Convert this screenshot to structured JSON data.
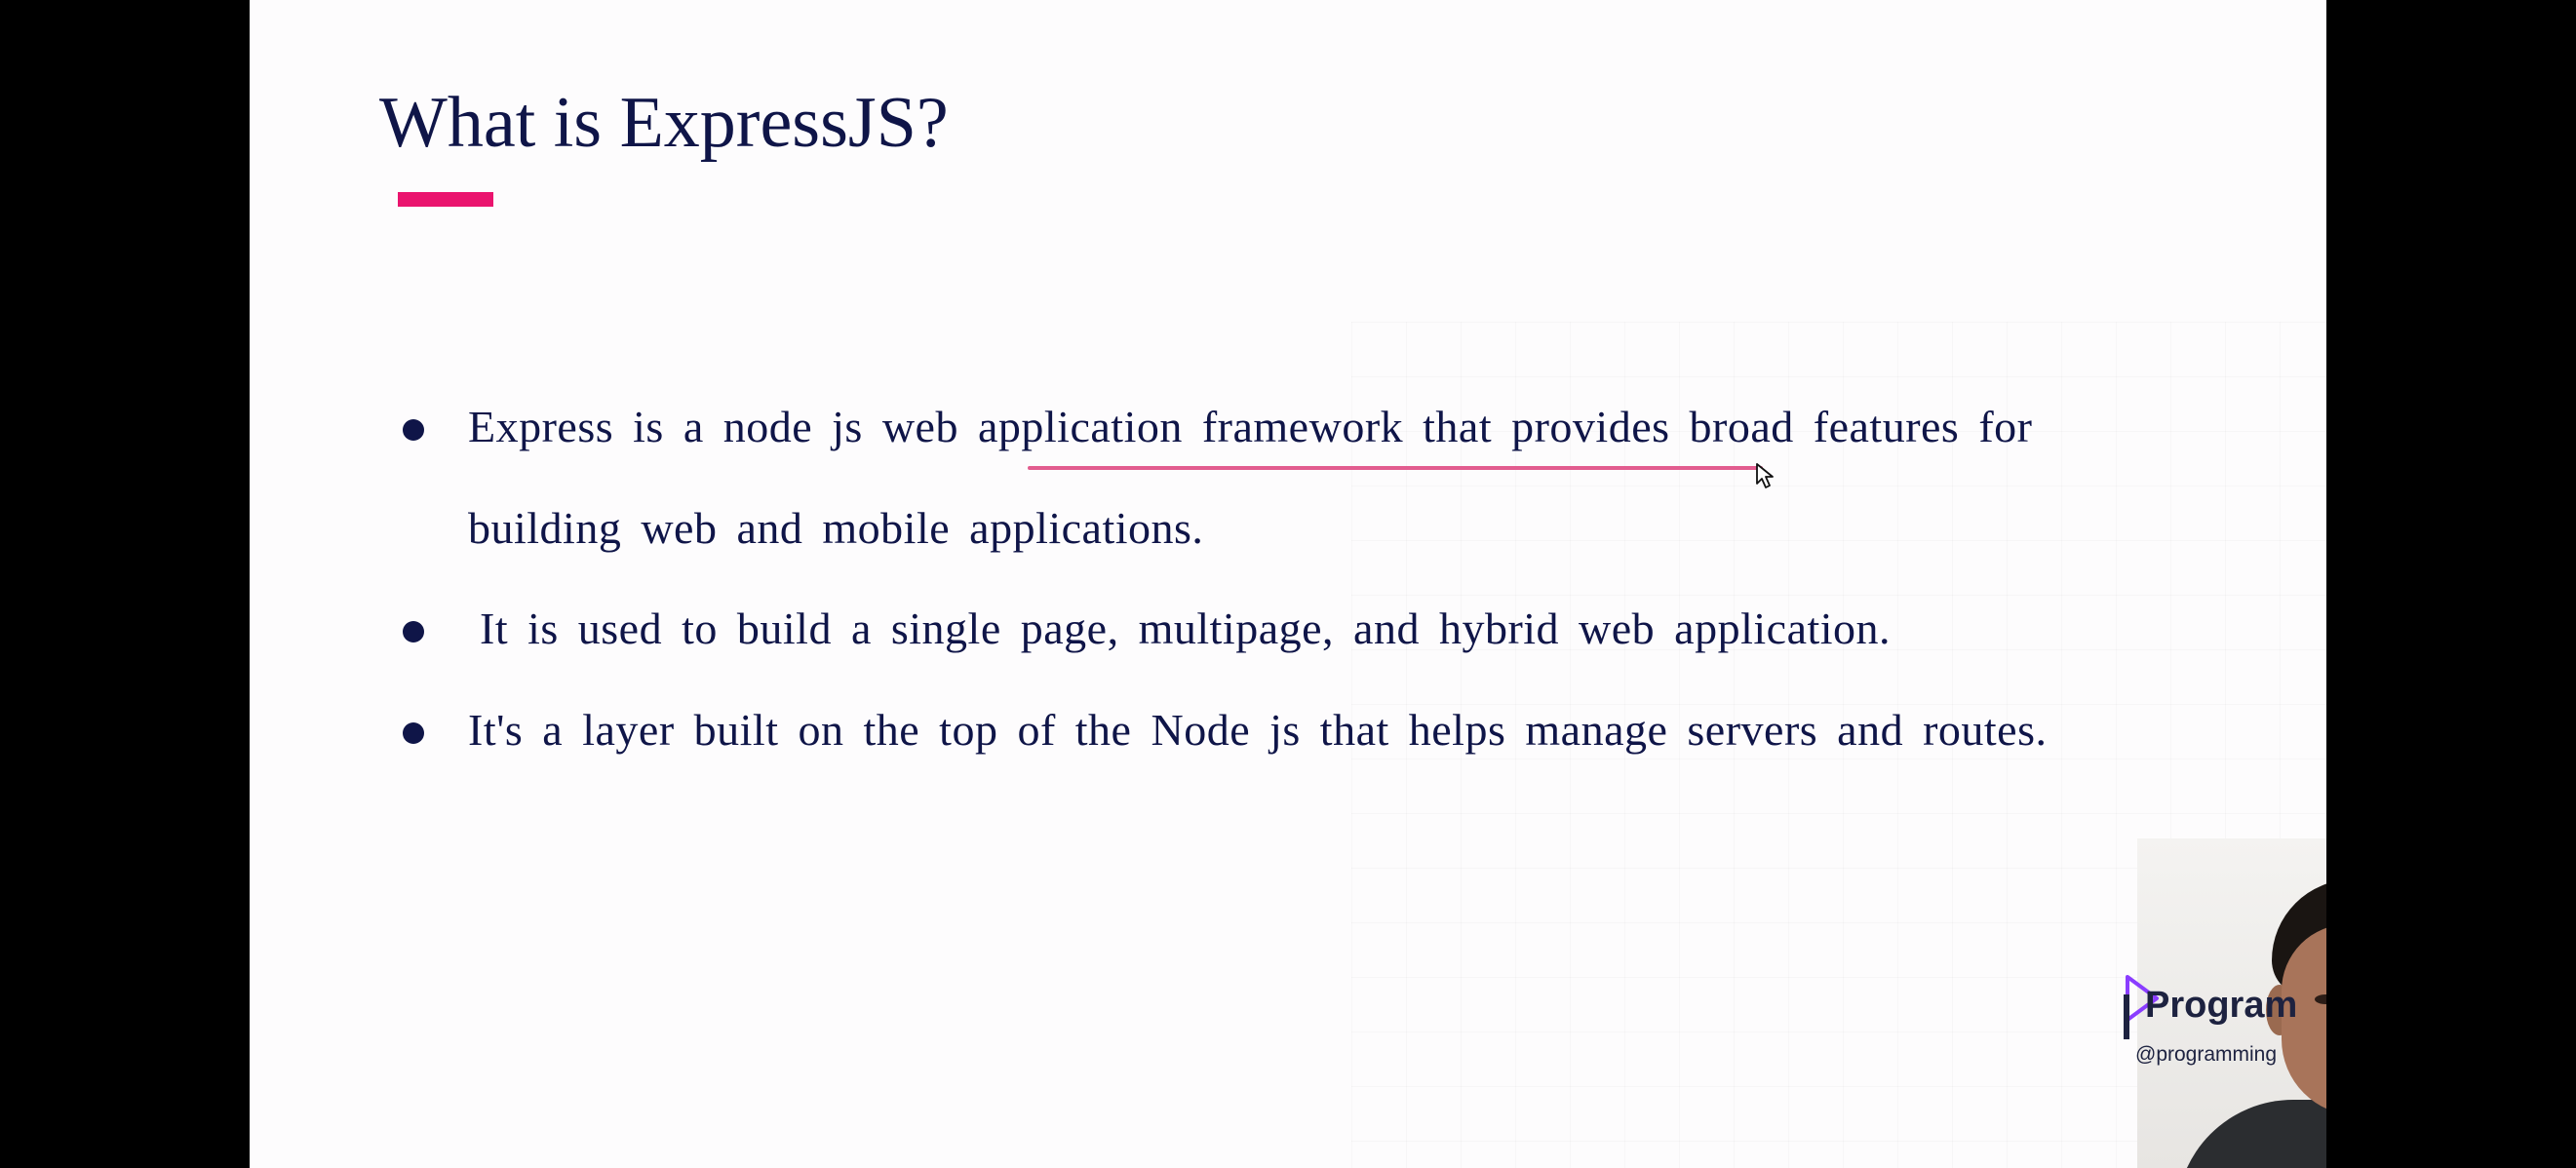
{
  "slide": {
    "title": "What is ExpressJS?",
    "accent_color": "#ea146e",
    "text_color": "#0f1548",
    "bullets": [
      {
        "lines": [
          "Express is a node js web application framework that provides broad features for",
          "building web and mobile applications."
        ]
      },
      {
        "lines": [
          "It is used to build a single page, multipage, and hybrid web application."
        ]
      },
      {
        "lines": [
          "It's a layer built on the top of the Node js that helps manage servers and routes."
        ]
      }
    ],
    "annotation": {
      "type": "pen-underline",
      "underlined_text": "application framework",
      "color": "#e25c8f"
    }
  },
  "overlay": {
    "logo": {
      "name": "Program",
      "handle": "@programming",
      "icon": "play-logo-icon"
    },
    "webcam": {
      "type": "presenter-video"
    },
    "cursor_icon": "hand-pointer-icon"
  }
}
